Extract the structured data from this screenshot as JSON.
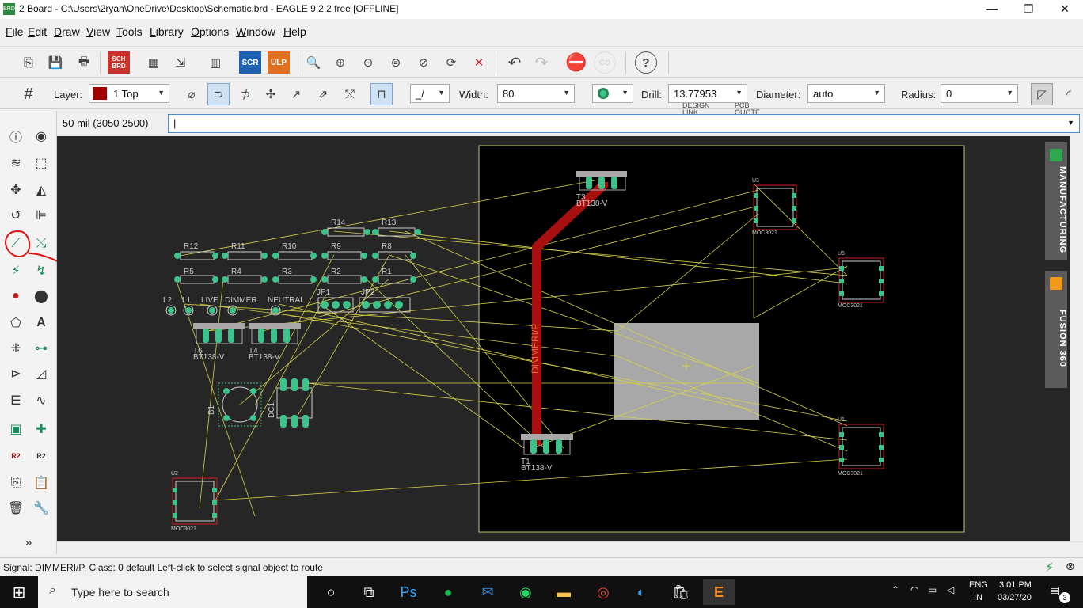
{
  "window": {
    "title": "2 Board - C:\\Users\\2ryan\\OneDrive\\Desktop\\Schematic.brd - EAGLE 9.2.2 free [OFFLINE]",
    "icon_label": "BRD",
    "minimize": "—",
    "restore": "❐",
    "close": "✕"
  },
  "menu": [
    {
      "u": "F",
      "rest": "ile"
    },
    {
      "u": "E",
      "rest": "dit"
    },
    {
      "u": "D",
      "rest": "raw"
    },
    {
      "u": "V",
      "rest": "iew"
    },
    {
      "u": "T",
      "rest": "ools"
    },
    {
      "u": "L",
      "rest": "ibrary"
    },
    {
      "u": "O",
      "rest": "ptions"
    },
    {
      "u": "W",
      "rest": "indow"
    },
    {
      "u": "H",
      "rest": "elp"
    }
  ],
  "toolbar1": {
    "sch_label": "SCH BRD",
    "scr_label": "SCR",
    "ulp_label": "ULP",
    "design_link": "DESIGN LINK",
    "pcb_quote": "PCB QUOTE",
    "help": "?",
    "go": "GO"
  },
  "toolbar2": {
    "layer_label": "Layer:",
    "layer_value": "1 Top",
    "layer_color": "#a00000",
    "width_label": "Width:",
    "width_value": "80",
    "drill_label": "Drill:",
    "drill_value": "13.77953",
    "diameter_label": "Diameter:",
    "diameter_value": "auto",
    "radius_label": "Radius:",
    "radius_value": "0"
  },
  "command": {
    "coords": "50 mil (3050 2500)",
    "input_value": "|"
  },
  "board": {
    "signal_label": "DIMMERI/P",
    "accent_trace": "#a81010",
    "ratsnest": "#d6d24a",
    "pad_color": "#3cc28a",
    "parts": [
      {
        "name": "T3",
        "value": "BT138-V"
      },
      {
        "name": "T6",
        "value": "BT138-V"
      },
      {
        "name": "T4",
        "value": "BT138-V"
      },
      {
        "name": "T1",
        "value": "BT138-V"
      },
      {
        "name": "U3",
        "value": "MOC3021"
      },
      {
        "name": "U5",
        "value": "MOC3021"
      },
      {
        "name": "U1",
        "value": "MOC3021"
      },
      {
        "name": "U2",
        "value": "MOC3021"
      },
      {
        "name": "B1",
        "value": ""
      },
      {
        "name": "DC1",
        "value": ""
      }
    ],
    "resistors_row1": [
      "R14",
      "R13"
    ],
    "resistors_row2": [
      "R12",
      "R11",
      "R10",
      "R9",
      "R8"
    ],
    "resistors_row3": [
      "R5",
      "R4",
      "R3",
      "R2",
      "R1"
    ],
    "connectors": [
      "L2",
      "L1",
      "LIVE",
      "DIMMER",
      "NEUTRAL",
      "JP1",
      "JP2"
    ]
  },
  "side_tabs": [
    "MANUFACTURING",
    "FUSION 360"
  ],
  "status": {
    "text": "Signal: DIMMERI/P, Class: 0 default Left-click to select signal object to route"
  },
  "taskbar": {
    "search_placeholder": "Type here to search",
    "lang1": "ENG",
    "lang2": "IN",
    "time": "3:01 PM",
    "date": "03/27/20",
    "notifications": "3"
  }
}
